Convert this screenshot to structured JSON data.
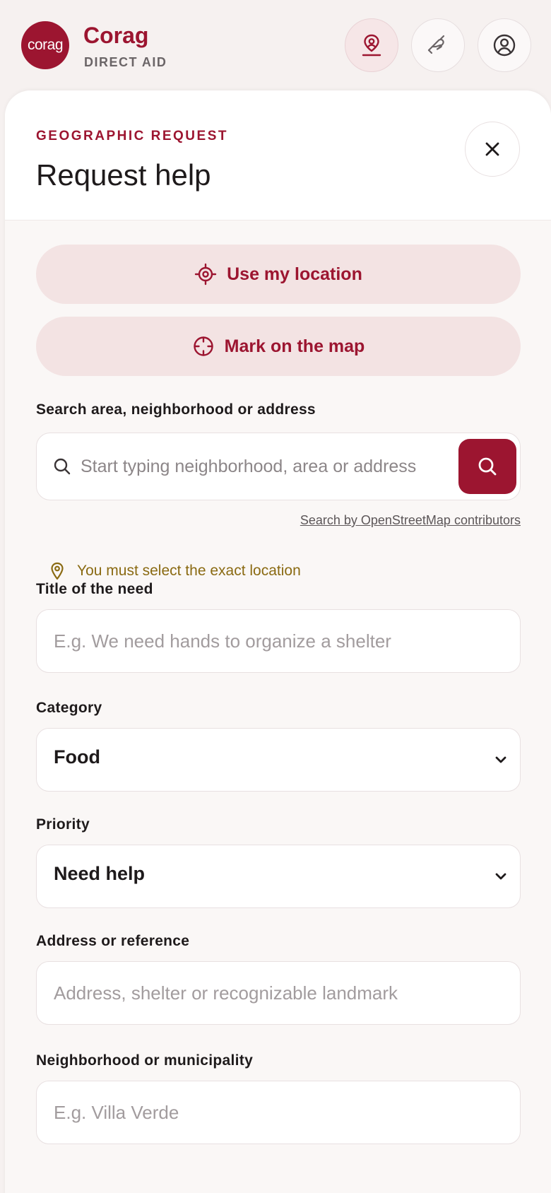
{
  "header": {
    "logo_text": "corag",
    "brand_name": "Corag",
    "brand_sub": "DIRECT AID",
    "icons": [
      "map-pin-person-icon",
      "helping-hand-icon",
      "user-account-icon"
    ]
  },
  "panel": {
    "eyebrow": "GEOGRAPHIC REQUEST",
    "title": "Request help",
    "use_location_label": "Use my location",
    "mark_map_label": "Mark on the map",
    "search": {
      "label": "Search area, neighborhood or address",
      "placeholder": "Start typing neighborhood, area or address",
      "value": "",
      "attribution": "Search by OpenStreetMap contributors"
    },
    "warning": "You must select the exact location",
    "title_field": {
      "label": "Title of the need",
      "placeholder": "E.g. We need hands to organize a shelter"
    },
    "category": {
      "label": "Category",
      "value": "Food"
    },
    "priority": {
      "label": "Priority",
      "value": "Need help"
    },
    "address": {
      "label": "Address or reference",
      "placeholder": "Address, shelter or recognizable landmark"
    },
    "neighborhood": {
      "label": "Neighborhood or municipality",
      "placeholder": "E.g. Villa Verde"
    }
  },
  "colors": {
    "accent": "#9c1530",
    "warning": "#8a6a12",
    "background": "#f6f1f0"
  }
}
